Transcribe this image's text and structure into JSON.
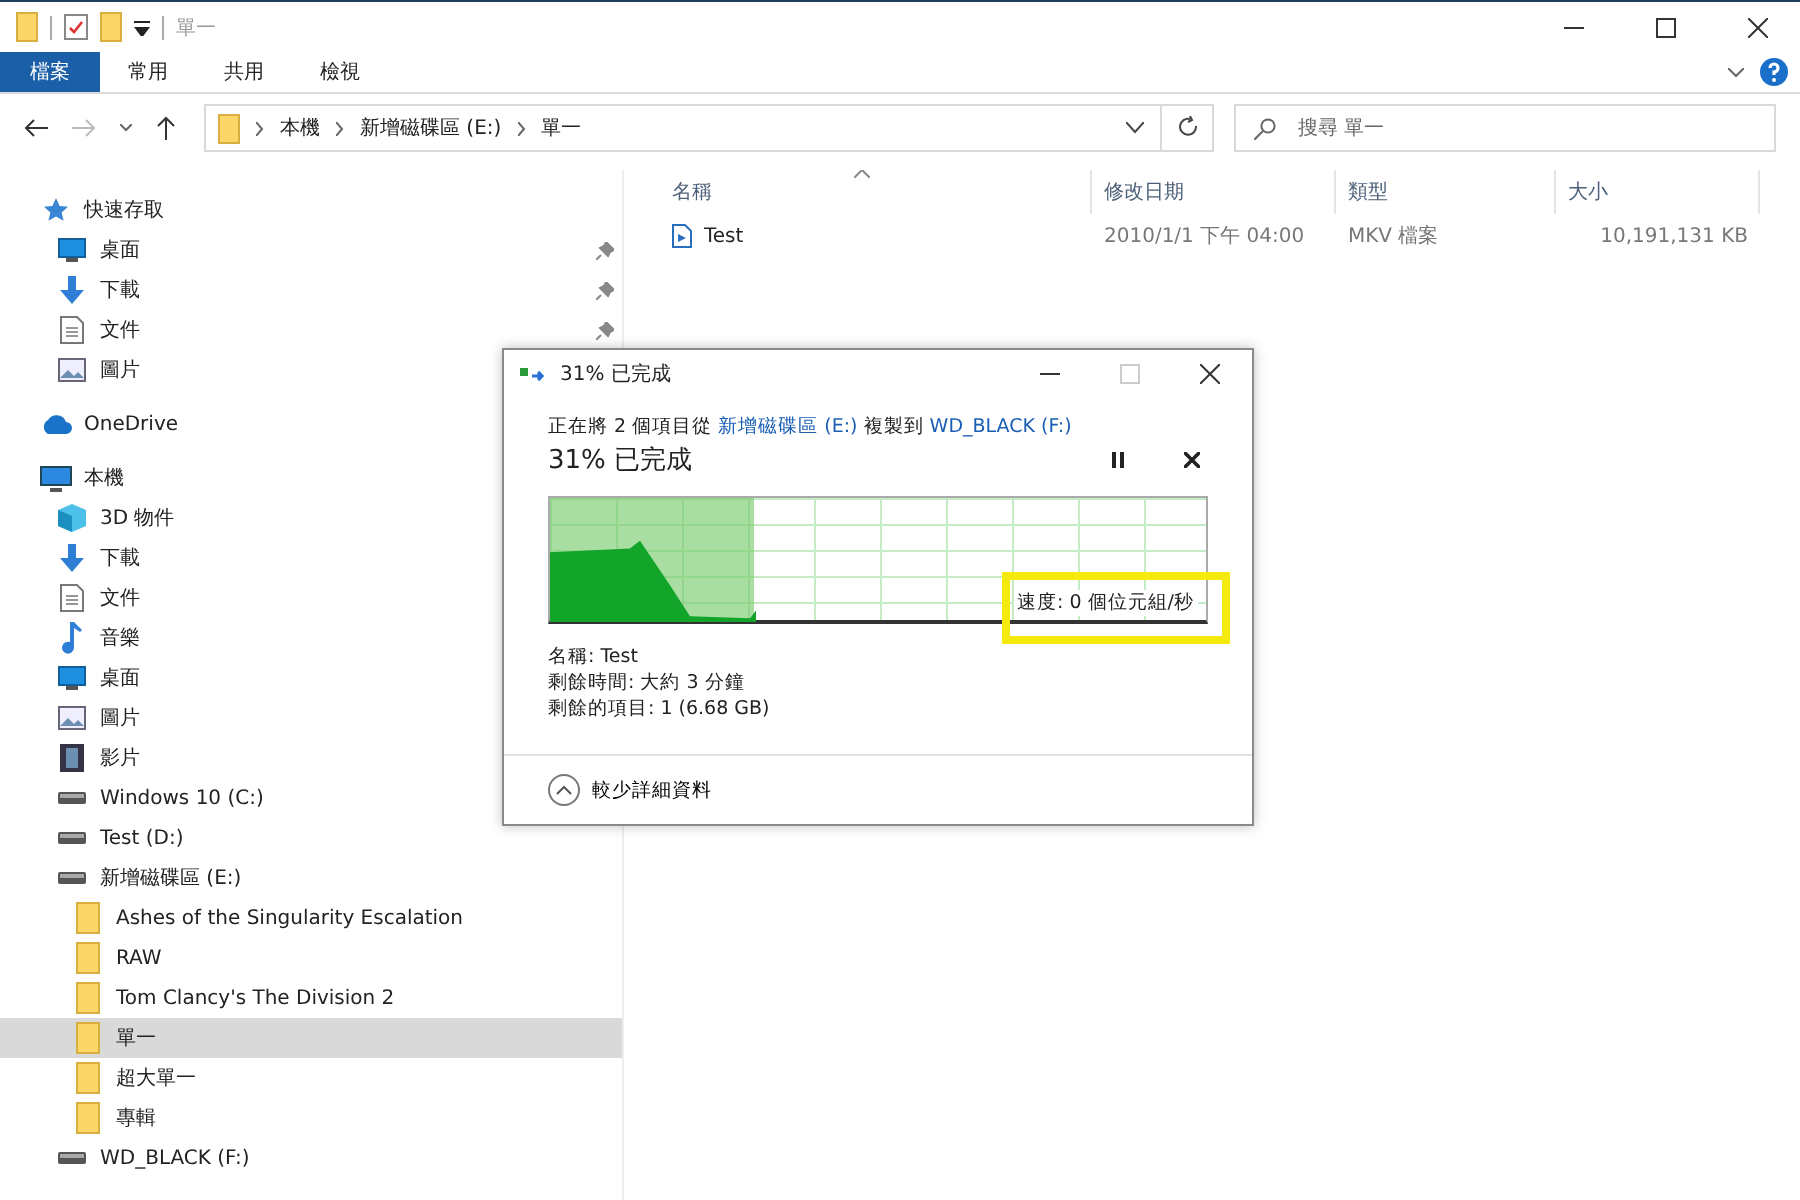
{
  "window": {
    "title": "單一"
  },
  "ribbon_tabs": [
    {
      "label": "檔案",
      "selected": true
    },
    {
      "label": "常用",
      "selected": false
    },
    {
      "label": "共用",
      "selected": false
    },
    {
      "label": "檢視",
      "selected": false
    }
  ],
  "address_bar": {
    "crumbs": [
      "本機",
      "新增磁碟區 (E:)",
      "單一"
    ]
  },
  "search": {
    "placeholder": "搜尋 單一"
  },
  "nav_items": [
    {
      "label": "快速存取",
      "kind": "star",
      "selected": false,
      "children": [
        {
          "label": "桌面",
          "kind": "desktop",
          "pinned": true,
          "selected": false
        },
        {
          "label": "下載",
          "kind": "download",
          "pinned": true,
          "selected": false
        },
        {
          "label": "文件",
          "kind": "document",
          "pinned": true,
          "selected": false
        },
        {
          "label": "圖片",
          "kind": "picture",
          "selected": false
        }
      ]
    },
    {
      "label": "OneDrive",
      "kind": "cloud",
      "selected": false
    },
    {
      "label": "本機",
      "kind": "computer",
      "selected": false,
      "children": [
        {
          "label": "3D 物件",
          "kind": "cube",
          "selected": false
        },
        {
          "label": "下載",
          "kind": "download",
          "selected": false
        },
        {
          "label": "文件",
          "kind": "document",
          "selected": false
        },
        {
          "label": "音樂",
          "kind": "music",
          "selected": false
        },
        {
          "label": "桌面",
          "kind": "desktop",
          "selected": false
        },
        {
          "label": "圖片",
          "kind": "picture",
          "selected": false
        },
        {
          "label": "影片",
          "kind": "video",
          "selected": false
        },
        {
          "label": "Windows 10 (C:)",
          "kind": "drive",
          "selected": false
        },
        {
          "label": "Test (D:)",
          "kind": "drive",
          "selected": false
        },
        {
          "label": "新增磁碟區 (E:)",
          "kind": "drive",
          "selected": false,
          "children": [
            {
              "label": "Ashes of the Singularity Escalation",
              "kind": "folder",
              "selected": false
            },
            {
              "label": "RAW",
              "kind": "folder",
              "selected": false
            },
            {
              "label": "Tom Clancy's The Division 2",
              "kind": "folder",
              "selected": false
            },
            {
              "label": "單一",
              "kind": "folder",
              "selected": true
            },
            {
              "label": "超大單一",
              "kind": "folder",
              "selected": false
            },
            {
              "label": "專輯",
              "kind": "folder",
              "selected": false
            }
          ]
        },
        {
          "label": "WD_BLACK (F:)",
          "kind": "drive",
          "selected": false
        }
      ]
    }
  ],
  "file_list": {
    "columns": [
      "名稱",
      "修改日期",
      "類型",
      "大小"
    ],
    "rows": [
      {
        "name": "Test",
        "modified": "2010/1/1 下午 04:00",
        "type": "MKV 檔案",
        "size": "10,191,131 KB"
      }
    ]
  },
  "copy_dialog": {
    "title": "31% 已完成",
    "description": {
      "prefix": "正在將 2 個項目從",
      "source": "新增磁碟區 (E:)",
      "middle": "複製到",
      "destination": "WD_BLACK (F:)"
    },
    "heading": "31% 已完成",
    "level": 0.31,
    "speed": "速度: 0 個位元組/秒",
    "details": [
      "名稱: Test",
      "剩餘時間: 大約 3 分鐘",
      "剩餘的項目: 1 (6.68 GB)"
    ],
    "toggle": "較少詳細資料"
  }
}
